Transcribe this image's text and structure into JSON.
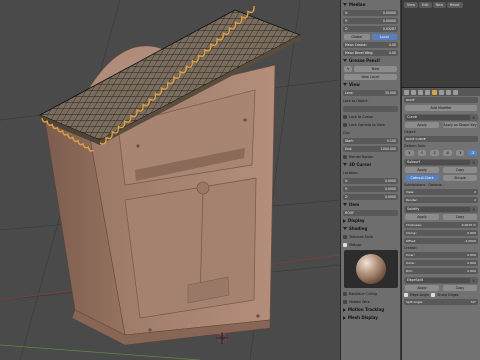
{
  "npanel": {
    "sections": [
      {
        "title": "Median"
      },
      {
        "title": "Grease Pencil"
      },
      {
        "title": "View"
      },
      {
        "title": "3D Cursor"
      },
      {
        "title": "Item"
      },
      {
        "title": "Display"
      },
      {
        "title": "Shading"
      },
      {
        "title": "Motion Tracking"
      },
      {
        "title": "Mesh Display"
      }
    ],
    "median": {
      "x_label": "X:",
      "x_value": "0.00000",
      "y_label": "Y:",
      "y_value": "0.00000",
      "z_label": "Z:",
      "z_value": "0.03287",
      "global": "Global",
      "local": "Local",
      "mean_crease_label": "Mean Crease:",
      "mean_crease_value": "0.00",
      "mean_bevel_label": "Mean Bevel Weig:",
      "mean_bevel_value": "0.00"
    },
    "grease": {
      "new_label": "New",
      "new_layer": "New Layer"
    },
    "view": {
      "lens_label": "Lens:",
      "lens_value": "35.000",
      "lock_to_object": "Lock to Object:",
      "lock_cursor": "Lock to Cursor",
      "lock_camera": "Lock Camera to View",
      "clip": "Clip:",
      "start_label": "Start:",
      "start_value": "0.100",
      "end_label": "End:",
      "end_value": "1000.000",
      "render_border": "Render Border"
    },
    "cursor": {
      "location": "Location:",
      "x_label": "X:",
      "x_value": "0.0000",
      "y_label": "Y:",
      "y_value": "0.0000",
      "z_label": "Z:",
      "z_value": "0.0000"
    },
    "item": {
      "name": "ROOF"
    },
    "shading": {
      "textured_solid": "Textured Solid",
      "matcap": "Matcap"
    },
    "display2": {
      "backface": "Backface Culling",
      "hidden_wire": "Hidden Wire"
    }
  },
  "props": {
    "tabs": [
      "View",
      "Edit",
      "New",
      "Reset"
    ],
    "object_name": "ROOF",
    "panel_title": "Add Modifier",
    "curve_mod": {
      "label": "Curve",
      "apply": "Apply",
      "apply_as_shape": "Apply as Shape Key",
      "object_label": "Object:",
      "object_value": "ROOF CURVE",
      "deform_axis": "Deform Axis:",
      "axes": [
        "X",
        "Y",
        "Z",
        "-X",
        "-Y",
        "-Z"
      ]
    },
    "subsurf": {
      "label": "Subsurf",
      "apply": "Apply",
      "copy": "Copy",
      "catmull": "Catmull-Clark",
      "simple": "Simple",
      "subdivisions": "Subdivisions:",
      "view_label": "View:",
      "view_value": "2",
      "render_label": "Render:",
      "render_value": "2",
      "options": "Options:"
    },
    "solidify": {
      "label": "Solidify",
      "apply": "Apply",
      "copy": "Copy",
      "thickness_label": "Thickness:",
      "thickness_value": "0.0015 m",
      "clamp_label": "Clamp:",
      "clamp_value": "0.000",
      "offset_label": "Offset:",
      "offset_value": "-1.0000",
      "crease": "Crease:",
      "inner_label": "Inner:",
      "inner_value": "0.000",
      "outer_label": "Outer:",
      "outer_value": "0.000",
      "rim_label": "Rim:",
      "rim_value": "0.000"
    },
    "edgesplit": {
      "label": "EdgeSplit",
      "apply": "Apply",
      "copy": "Copy",
      "edge_angle": "Edge Angle",
      "sharp_edges": "Sharp Edges",
      "split_angle_label": "Split Angle:",
      "split_angle_value": "30°"
    }
  },
  "colors": {
    "accent": "#5680c2",
    "mailbox": "#a88573",
    "roof": "#6e6355",
    "viewport_bg": "#4a4a4a"
  }
}
